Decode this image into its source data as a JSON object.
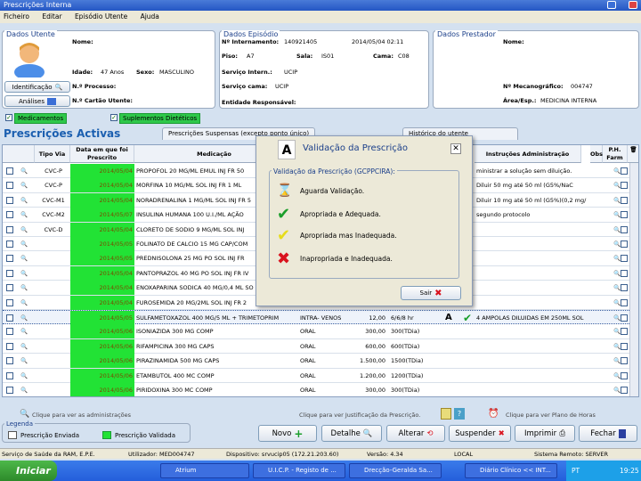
{
  "window": {
    "title": "Prescrições Interna"
  },
  "menu": [
    "Ficheiro",
    "Editar",
    "Episódio Utente",
    "Ajuda"
  ],
  "utente": {
    "title": "Dados Utente",
    "nome_label": "Nome:",
    "idade_label": "Idade:",
    "idade": "47 Anos",
    "sexo_label": "Sexo:",
    "sexo": "MASCULINO",
    "processo_label": "N.º Processo:",
    "cartao_label": "N.º Cartão Utente:",
    "identificacao_btn": "Identificação",
    "analises_btn": "Análises"
  },
  "episodio": {
    "title": "Dados Episódio",
    "internamento_label": "Nº Internamento:",
    "internamento": "140921405",
    "data": "2014/05/04 02:11",
    "piso_label": "Piso:",
    "piso": "A7",
    "sala_label": "Sala:",
    "sala": "IS01",
    "cama_label": "Cama:",
    "cama": "C08",
    "servico_label": "Serviço Intern.:",
    "servico": "UCIP",
    "servico_cama_label": "Serviço cama:",
    "servico_cama": "UCIP",
    "entidade_label": "Entidade Responsável:"
  },
  "prestador": {
    "title": "Dados Prestador",
    "nome_label": "Nome:",
    "mecanografico_label": "Nº Mecanográfico:",
    "mecanografico": "004747",
    "area_label": "Área/Esp.:",
    "area": "MEDICINA INTERNA"
  },
  "filters": {
    "medicamentos": "Medicamentos",
    "suplementos": "Suplementos Dietéticos"
  },
  "tabs": {
    "ativas": "Prescrições Activas",
    "suspensas": "Prescrições Suspensas (excepto ponto único)",
    "historico": "Histórico do utente"
  },
  "columns": {
    "tipo_via": "Tipo Via",
    "data": "Data em que foi Prescrito",
    "medicacao": "Medicação",
    "instrucoes": "Instruções Administração",
    "obs": "Obs",
    "ph": "P.H. Farm"
  },
  "rows": [
    {
      "tipo": "CVC-P",
      "data": "2014/05/04",
      "med": "PROPOFOL 20 MG/ML EMUL INJ FR 50",
      "instr": "ministrar a solução sem diluição."
    },
    {
      "tipo": "CVC-P",
      "data": "2014/05/04",
      "med": "MORFINA 10 MG/ML SOL INJ FR 1 ML",
      "instr": "Diluir 50 mg até 50 ml (G5%/NaC"
    },
    {
      "tipo": "CVC-M1",
      "data": "2014/05/04",
      "med": "NORADRENALINA 1 MG/ML SOL INJ FR 5",
      "instr": "Diluir 10 mg até 50 ml (G5%)(0,2 mg/"
    },
    {
      "tipo": "CVC-M2",
      "data": "2014/05/07",
      "med": "INSULINA HUMANA 100 U.I./ML AÇÃO",
      "instr": "segundo protocolo"
    },
    {
      "tipo": "CVC-D",
      "data": "2014/05/04",
      "med": "CLORETO DE SODIO 9 MG/ML SOL INJ",
      "instr": ""
    },
    {
      "tipo": "",
      "data": "2014/05/05",
      "med": "FOLINATO DE CALCIO 15 MG CAP/COM",
      "instr": ""
    },
    {
      "tipo": "",
      "data": "2014/05/05",
      "med": "PREDNISOLONA 25 MG PO SOL INJ FR",
      "instr": ""
    },
    {
      "tipo": "",
      "data": "2014/05/04",
      "med": "PANTOPRAZOL 40 MG PO SOL INJ FR IV",
      "instr": ""
    },
    {
      "tipo": "",
      "data": "2014/05/04",
      "med": "ENOXAPARINA SODICA 40 MG/0,4 ML SO",
      "instr": ""
    },
    {
      "tipo": "",
      "data": "2014/05/04",
      "med": "FUROSEMIDA 20 MG/2ML SOL INJ FR 2",
      "instr": ""
    },
    {
      "tipo": "",
      "data": "2014/05/05",
      "med": "SULFAMETOXAZOL 400 MG/5 ML + TRIMETOPRIM",
      "via": "INTRA- VENOS",
      "dose": "12,00",
      "freq": "6/6/8 hr",
      "instr": "4 AMPOLAS DILUIDAS EM 250ML SOL"
    },
    {
      "tipo": "",
      "data": "2014/05/06",
      "med": "ISONIAZIDA 300 MG COMP",
      "via": "ORAL",
      "dose": "300,00",
      "freq": "300(TDia)",
      "instr": ""
    },
    {
      "tipo": "",
      "data": "2014/05/06",
      "med": "RIFAMPICINA 300 MG CAPS",
      "via": "ORAL",
      "dose": "600,00",
      "freq": "600(TDia)",
      "instr": ""
    },
    {
      "tipo": "",
      "data": "2014/05/06",
      "med": "PIRAZINAMIDA 500 MG CAPS",
      "via": "ORAL",
      "dose": "1.500,00",
      "freq": "1500(TDia)",
      "instr": ""
    },
    {
      "tipo": "",
      "data": "2014/05/06",
      "med": "ETAMBUTOL 400 MC COMP",
      "via": "ORAL",
      "dose": "1.200,00",
      "freq": "1200(TDia)",
      "instr": ""
    },
    {
      "tipo": "",
      "data": "2014/05/06",
      "med": "PIRIDOXINA 300 MC COMP",
      "via": "ORAL",
      "dose": "300,00",
      "freq": "300(TDia)",
      "instr": ""
    }
  ],
  "hints": {
    "admin": "Clique para ver as administrações",
    "justif": "Clique para ver Justificação da Prescrição.",
    "plano": "Clique para ver Plano de Horas"
  },
  "legend": {
    "title": "Legenda",
    "enviada": "Prescrição Enviada",
    "validada": "Prescrição Validada"
  },
  "buttons": {
    "novo": "Novo",
    "detalhe": "Detalhe",
    "alterar": "Alterar",
    "suspender": "Suspender",
    "imprimir": "Imprimir",
    "fechar": "Fechar"
  },
  "dialog": {
    "title": "Validação da Prescrição",
    "group": "Validação da Prescrição (GCPPCIRA):",
    "aguarda": "Aguarda Validação.",
    "apropriada": "Apropriada e Adequada.",
    "apropriada_inad": "Apropriada mas Inadequada.",
    "inapropriada": "Inapropriada e Inadequada.",
    "sair": "Sair"
  },
  "status": {
    "org": "Serviço de Saúde da RAM, E.P.E.",
    "utilizador": "Utilizador: MED004747",
    "dispositivo": "Dispositivo: srvucip05 (172.21.203.60)",
    "versao": "Versão: 4.34",
    "local": "LOCAL",
    "sistema": "Sistema Remoto: SERVER"
  },
  "taskbar": {
    "start": "Iniciar",
    "tasks": [
      "Atrium",
      "U.I.C.P. - Registo de ...",
      "Drecção-Geralda Sa...",
      "Diário Clínico << INT..."
    ],
    "lang": "PT",
    "clock": "19:25"
  },
  "colors": {
    "green": "#22e235",
    "valid_check": "#1a9e2a",
    "invalid_x": "#d9121d",
    "warn": "#e6dc1a"
  }
}
